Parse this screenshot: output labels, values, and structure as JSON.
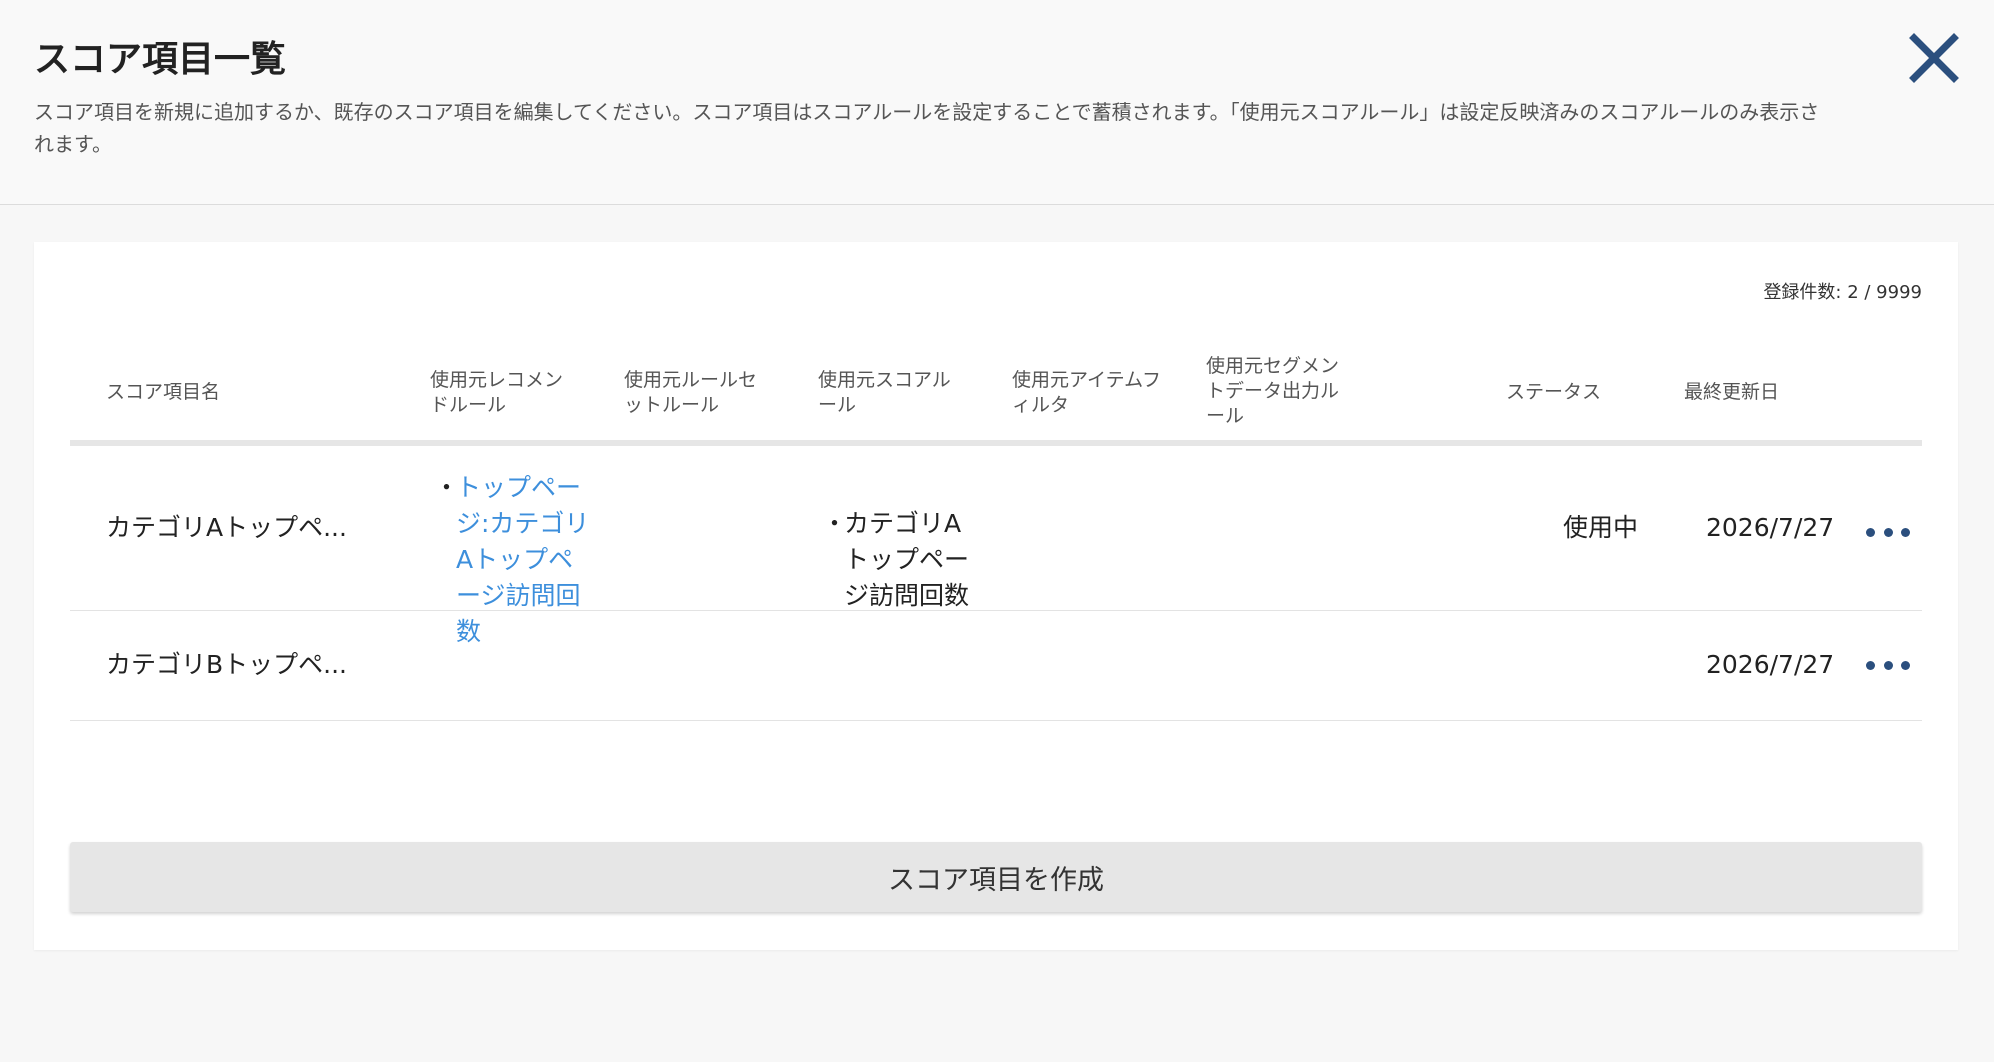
{
  "header": {
    "title": "スコア項目一覧",
    "description": "スコア項目を新規に追加するか、既存のスコア項目を編集してください。スコア項目はスコアルールを設定することで蓄積されます。「使用元スコアルール」は設定反映済みのスコアルールのみ表示されます。",
    "close_icon": "close-icon",
    "close_color": "#2b4f7e"
  },
  "table": {
    "count_label": "登録件数: 2 / 9999",
    "columns": [
      "スコア項目名",
      "使用元レコメンドルール",
      "使用元ルールセットルール",
      "使用元スコアルール",
      "使用元アイテムフィルタ",
      "使用元セグメントデータ出力ルール",
      "ステータス",
      "最終更新日"
    ],
    "rows": [
      {
        "name": "カテゴリAトップペ...",
        "recommend_rules": [
          "トップページ:カテゴリAトップページ訪問回数"
        ],
        "score_rules": [
          "カテゴリAトップページ訪問回数"
        ],
        "status": "使用中",
        "updated": "2026/7/27",
        "menu_icon": "more-icon"
      },
      {
        "name": "カテゴリBトップペ...",
        "recommend_rules": [],
        "score_rules": [],
        "status": "",
        "updated": "2026/7/27",
        "menu_icon": "more-icon"
      }
    ]
  },
  "create_button_label": "スコア項目を作成",
  "colors": {
    "link": "#3d8fdc",
    "accent": "#2b4f7e",
    "button_bg": "#e6e6e6"
  }
}
